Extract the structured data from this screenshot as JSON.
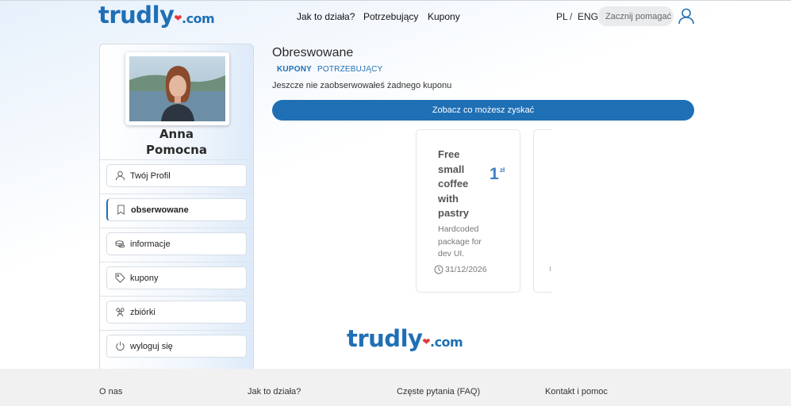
{
  "header": {
    "logo": {
      "main": "trudly",
      "heart": "❤",
      "suffix": ".com"
    },
    "nav": [
      "Jak to działa?",
      "Potrzebujący",
      "Kupony"
    ],
    "lang": {
      "pl": "PL",
      "sep": "/",
      "eng": "ENG"
    },
    "search_placeholder": "Zacznij pomagać",
    "user_icon": "user-icon"
  },
  "sidebar": {
    "avatar_icon": "profile-photo",
    "first_name": "Anna",
    "last_name": "Pomocna",
    "items": [
      {
        "label": "Twój Profil",
        "icon": "user-icon",
        "active": false
      },
      {
        "label": "obserwowane",
        "icon": "bookmark-icon",
        "active": true
      },
      {
        "label": "informacje",
        "icon": "coins-icon",
        "active": false
      },
      {
        "label": "kupony",
        "icon": "tag-icon",
        "active": false
      },
      {
        "label": "zbiórki",
        "icon": "people-icon",
        "active": false
      },
      {
        "label": "wyloguj się",
        "icon": "power-icon",
        "active": false
      }
    ]
  },
  "main": {
    "title": "Obreswowane",
    "tabs": [
      "KUPONY",
      "POTRZEBUJĄCY"
    ],
    "empty_message": "Jeszcze nie zaobserwowałeś żadnego kuponu",
    "cta_label": "Zobacz co możesz zyskać",
    "card": {
      "title": "Free small coffee with pastry",
      "price": "1",
      "currency": "zł",
      "description": "Hardcoded package for dev UI.",
      "date": "31/12/2026"
    }
  },
  "footer": {
    "links": [
      "O nas",
      "Jak to działa?",
      "Częste pytania (FAQ)",
      "Kontakt i pomoc"
    ]
  },
  "colors": {
    "brand": "#1f6fb5",
    "heart": "#e0393b",
    "footer_bg": "#f1f1f1"
  }
}
